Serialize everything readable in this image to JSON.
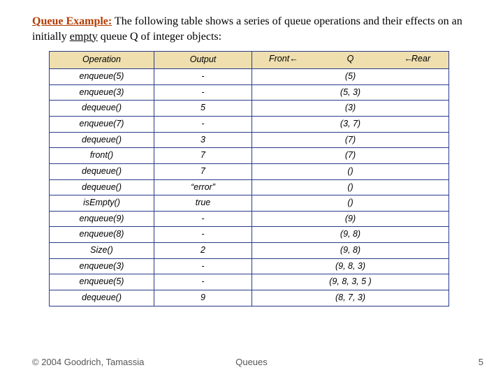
{
  "heading": {
    "title": "Queue Example:",
    "rest_before_emph": " The following table shows a series of queue operations and their effects on an initially ",
    "emph": "empty",
    "rest_after_emph": " queue Q of integer objects:"
  },
  "table": {
    "headers": {
      "operation": "Operation",
      "output": "Output",
      "front": "Front",
      "q": "Q",
      "rear": "Rear"
    },
    "rows": [
      {
        "op": "enqueue(5)",
        "out": "-",
        "state": "(5)"
      },
      {
        "op": "enqueue(3)",
        "out": "-",
        "state": "(5, 3)"
      },
      {
        "op": "dequeue()",
        "out": "5",
        "state": "(3)"
      },
      {
        "op": "enqueue(7)",
        "out": "-",
        "state": "(3, 7)"
      },
      {
        "op": "dequeue()",
        "out": "3",
        "state": "(7)"
      },
      {
        "op": "front()",
        "out": "7",
        "state": "(7)"
      },
      {
        "op": "dequeue()",
        "out": "7",
        "state": "()"
      },
      {
        "op": "dequeue()",
        "out": "“error”",
        "state": "()"
      },
      {
        "op": "isEmpty()",
        "out": "true",
        "state": "()"
      },
      {
        "op": "enqueue(9)",
        "out": "-",
        "state": "(9)"
      },
      {
        "op": "enqueue(8)",
        "out": "-",
        "state": "(9, 8)"
      },
      {
        "op": "Size()",
        "out": "2",
        "state": "(9, 8)"
      },
      {
        "op": "enqueue(3)",
        "out": "-",
        "state": "(9, 8, 3)"
      },
      {
        "op": "enqueue(5)",
        "out": "-",
        "state": "(9, 8, 3, 5 )"
      },
      {
        "op": "dequeue()",
        "out": "9",
        "state": "(8, 7, 3)"
      }
    ]
  },
  "footer": {
    "copyright": "© 2004 Goodrich, Tamassia",
    "center": "Queues",
    "page": "5"
  },
  "arrows": {
    "left": "←",
    "right": "→"
  }
}
